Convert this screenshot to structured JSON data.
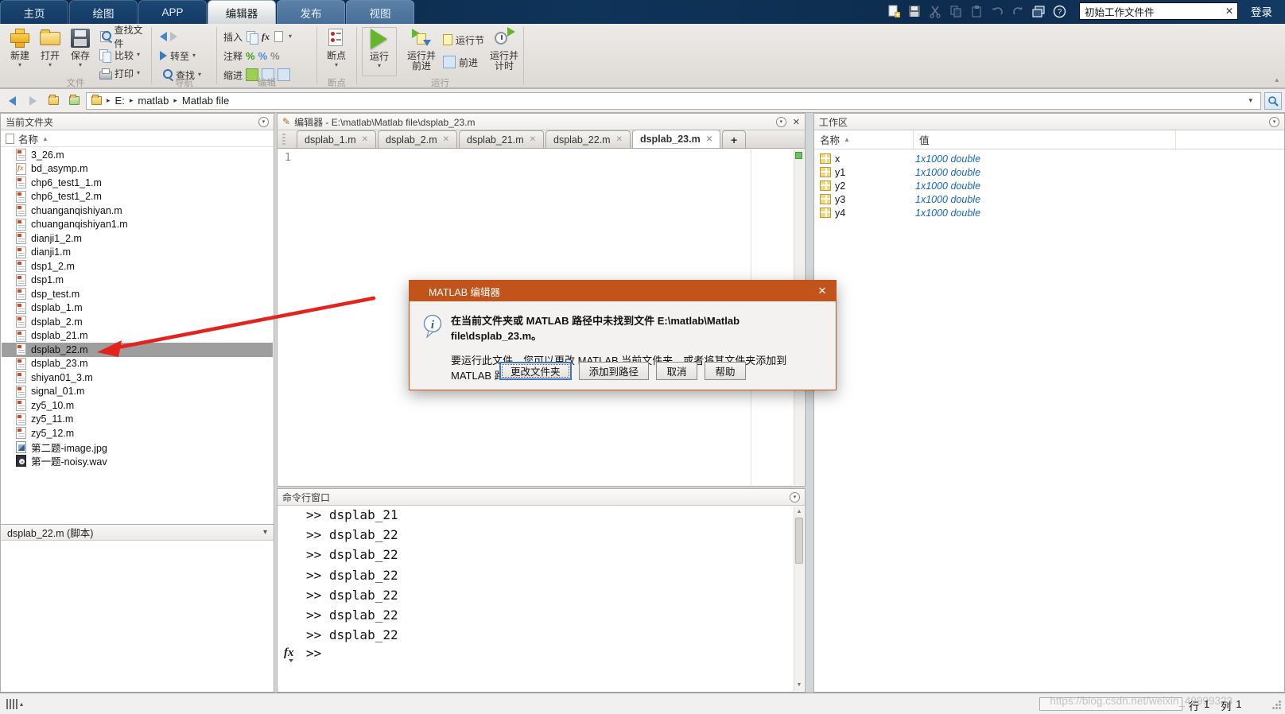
{
  "titlebar": {
    "tabs": [
      {
        "label": "主页",
        "state": "normal"
      },
      {
        "label": "绘图",
        "state": "normal"
      },
      {
        "label": "APP",
        "state": "normal"
      },
      {
        "label": "编辑器",
        "state": "active"
      },
      {
        "label": "发布",
        "state": "contextual"
      },
      {
        "label": "视图",
        "state": "contextual"
      }
    ],
    "search_value": "初始工作文件件",
    "signin_label": "登录"
  },
  "icons": {
    "close": "✕",
    "chevron_down": "▾",
    "chevron_up": "▴",
    "sort_asc": "▲",
    "breadcrumb_sep": "▸",
    "scroll_up": "▲",
    "scroll_down": "▼"
  },
  "ribbon": {
    "file_group": {
      "label": "文件",
      "new": "新建",
      "open": "打开",
      "save": "保存",
      "find_files": "查找文件",
      "compare": "比较",
      "print": "打印"
    },
    "nav_group": {
      "label": "导航",
      "goto": "转至",
      "find": "查找"
    },
    "edit_group": {
      "label": "编辑",
      "insert": "插入",
      "comment": "注释",
      "indent": "缩进",
      "comment_pct": "%",
      "comment_pct_x": "%",
      "comment_pct_j": "%"
    },
    "breakpoint_group": {
      "label": "断点",
      "button": "断点"
    },
    "run_group": {
      "label": "运行",
      "run": "运行",
      "run_advance": "运行并\n前进",
      "run_section": "运行节",
      "advance": "前进",
      "run_time": "运行并\n计时"
    }
  },
  "addressbar": {
    "path": [
      "E:",
      "matlab",
      "Matlab file"
    ]
  },
  "current_folder": {
    "title": "当前文件夹",
    "name_header": "名称",
    "files": [
      {
        "name": "3_26.m",
        "type": "m"
      },
      {
        "name": "bd_asymp.m",
        "type": "fx"
      },
      {
        "name": "chp6_test1_1.m",
        "type": "m"
      },
      {
        "name": "chp6_test1_2.m",
        "type": "m"
      },
      {
        "name": "chuanganqishiyan.m",
        "type": "m"
      },
      {
        "name": "chuanganqishiyan1.m",
        "type": "m"
      },
      {
        "name": "dianji1_2.m",
        "type": "m"
      },
      {
        "name": "dianji1.m",
        "type": "m"
      },
      {
        "name": "dsp1_2.m",
        "type": "m"
      },
      {
        "name": "dsp1.m",
        "type": "m"
      },
      {
        "name": "dsp_test.m",
        "type": "m"
      },
      {
        "name": "dsplab_1.m",
        "type": "m"
      },
      {
        "name": "dsplab_2.m",
        "type": "m"
      },
      {
        "name": "dsplab_21.m",
        "type": "m"
      },
      {
        "name": "dsplab_22.m",
        "type": "m",
        "selected": true
      },
      {
        "name": "dsplab_23.m",
        "type": "m"
      },
      {
        "name": "shiyan01_3.m",
        "type": "m"
      },
      {
        "name": "signal_01.m",
        "type": "m"
      },
      {
        "name": "zy5_10.m",
        "type": "m"
      },
      {
        "name": "zy5_11.m",
        "type": "m"
      },
      {
        "name": "zy5_12.m",
        "type": "m"
      },
      {
        "name": "第二题-image.jpg",
        "type": "jpg"
      },
      {
        "name": "第一题-noisy.wav",
        "type": "wav"
      }
    ],
    "detail_text": "dsplab_22.m  (脚本)"
  },
  "editor": {
    "header_title": "编辑器 - E:\\matlab\\Matlab file\\dsplab_23.m",
    "tabs": [
      "dsplab_1.m",
      "dsplab_2.m",
      "dsplab_21.m",
      "dsplab_22.m",
      "dsplab_23.m"
    ],
    "active_tab_index": 4,
    "new_tab_label": "+",
    "first_line_number": "1"
  },
  "command_window": {
    "title": "命令行窗口",
    "clipped_line": ">> dsplab_21",
    "lines": [
      ">> dsplab_21",
      ">> dsplab_22",
      ">> dsplab_22",
      ">> dsplab_22",
      ">> dsplab_22",
      ">> dsplab_22",
      ">> dsplab_22"
    ],
    "fx_label": "fx",
    "prompt": ">>"
  },
  "workspace": {
    "title": "工作区",
    "name_header": "名称",
    "value_header": "值",
    "variables": [
      {
        "name": "x",
        "value": "1x1000 double"
      },
      {
        "name": "y1",
        "value": "1x1000 double"
      },
      {
        "name": "y2",
        "value": "1x1000 double"
      },
      {
        "name": "y3",
        "value": "1x1000 double"
      },
      {
        "name": "y4",
        "value": "1x1000 double"
      }
    ]
  },
  "dialog": {
    "title": "MATLAB 编辑器",
    "message_line1": "在当前文件夹或 MATLAB 路径中未找到文件 E:\\matlab\\Matlab file\\dsplab_23.m。",
    "message_line2": "要运行此文件，您可以更改 MATLAB 当前文件夹，或者将其文件夹添加到 MATLAB 路径。",
    "buttons": [
      {
        "label": "更改文件夹",
        "primary": true
      },
      {
        "label": "添加到路径",
        "primary": false
      },
      {
        "label": "取消",
        "primary": false
      },
      {
        "label": "帮助",
        "primary": false
      }
    ]
  },
  "statusbar": {
    "row_label": "行",
    "row_value": "1",
    "col_label": "列",
    "col_value": "1",
    "watermark": "https://blog.csdn.net/weixin_49999323"
  },
  "colors": {
    "accent_orange": "#c1531b",
    "titlebar_navy": "#0f3459",
    "run_green": "#64b62e",
    "arrow_red": "#e3231c",
    "value_blue": "#1566c0"
  }
}
